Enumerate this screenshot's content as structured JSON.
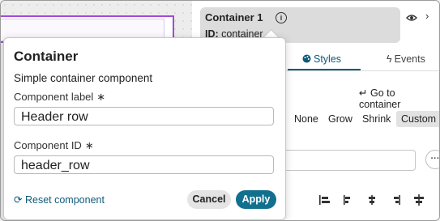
{
  "component_header": {
    "title": "Container 1",
    "id_label": "ID:",
    "id_value": "container"
  },
  "tabs": [
    {
      "label": "Styles",
      "active": true
    },
    {
      "label": "Events",
      "active": false
    }
  ],
  "styles": {
    "goto_label": "Go to container",
    "sizing_options": [
      "None",
      "Grow",
      "Shrink",
      "Custom"
    ],
    "selected_sizing": "Custom",
    "more_label": "···"
  },
  "popover": {
    "title": "Container",
    "subtitle": "Simple container component",
    "label_field_label": "Component label",
    "label_value": "Header row",
    "id_field_label": "Component ID",
    "id_value": "header_row",
    "required_mark": "∗",
    "reset_label": "Reset component",
    "cancel_label": "Cancel",
    "apply_label": "Apply"
  },
  "colors": {
    "accent": "#12708f",
    "selection": "#a24bd6"
  }
}
